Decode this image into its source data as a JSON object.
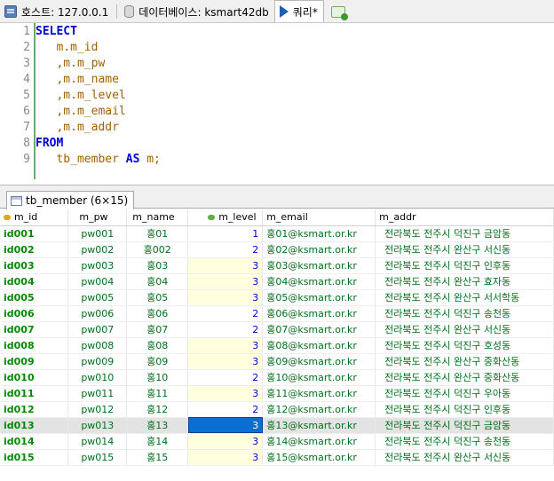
{
  "tabs": [
    {
      "label": "호스트: 127.0.0.1",
      "icon": "host-icon"
    },
    {
      "label": "데이터베이스: ksmart42db",
      "icon": "database-icon"
    },
    {
      "label": "쿼리*",
      "icon": "query-play-icon"
    }
  ],
  "editor": {
    "lines": [
      {
        "num": "1",
        "parts": [
          {
            "t": "SELECT",
            "c": "kw"
          }
        ]
      },
      {
        "num": "2",
        "parts": [
          {
            "t": "   m.m_id",
            "c": "id"
          }
        ]
      },
      {
        "num": "3",
        "parts": [
          {
            "t": "   ,m.m_pw",
            "c": "id"
          }
        ]
      },
      {
        "num": "4",
        "parts": [
          {
            "t": "   ,m.m_name",
            "c": "id"
          }
        ]
      },
      {
        "num": "5",
        "parts": [
          {
            "t": "   ,m.m_level",
            "c": "id"
          }
        ]
      },
      {
        "num": "6",
        "parts": [
          {
            "t": "   ,m.m_email",
            "c": "id"
          }
        ]
      },
      {
        "num": "7",
        "parts": [
          {
            "t": "   ,m.m_addr",
            "c": "id"
          }
        ]
      },
      {
        "num": "8",
        "parts": [
          {
            "t": "FROM",
            "c": "kw"
          }
        ]
      },
      {
        "num": "9",
        "parts": [
          {
            "t": "   tb_member ",
            "c": "id"
          },
          {
            "t": "AS",
            "c": "kw"
          },
          {
            "t": " m;",
            "c": "id"
          }
        ]
      }
    ]
  },
  "result_tab": {
    "label": "tb_member (6×15)"
  },
  "grid": {
    "columns": [
      "m_id",
      "m_pw",
      "m_name",
      "m_level",
      "m_email",
      "m_addr"
    ],
    "rows": [
      [
        "id001",
        "pw001",
        "홍01",
        "1",
        "홍01@ksmart.or.kr",
        "전라북도 전주시 덕진구 금암동"
      ],
      [
        "id002",
        "pw002",
        "홍002",
        "2",
        "홍02@ksmart.or.kr",
        "전라북도 전주시 완산구 서신동"
      ],
      [
        "id003",
        "pw003",
        "홍03",
        "3",
        "홍03@ksmart.or.kr",
        "전라북도 전주시 덕진구 인후동"
      ],
      [
        "id004",
        "pw004",
        "홍04",
        "3",
        "홍04@ksmart.or.kr",
        "전라북도 전주시 완산구 효자동"
      ],
      [
        "id005",
        "pw005",
        "홍05",
        "3",
        "홍05@ksmart.or.kr",
        "전라북도 전주시 완산구 서서학동"
      ],
      [
        "id006",
        "pw006",
        "홍06",
        "2",
        "홍06@ksmart.or.kr",
        "전라북도 전주시 덕진구 송천동"
      ],
      [
        "id007",
        "pw007",
        "홍07",
        "2",
        "홍07@ksmart.or.kr",
        "전라북도 전주시 완산구 서신동"
      ],
      [
        "id008",
        "pw008",
        "홍08",
        "3",
        "홍08@ksmart.or.kr",
        "전라북도 전주시 덕진구 호성동"
      ],
      [
        "id009",
        "pw009",
        "홍09",
        "3",
        "홍09@ksmart.or.kr",
        "전라북도 전주시 완산구 중화산동"
      ],
      [
        "id010",
        "pw010",
        "홍10",
        "2",
        "홍10@ksmart.or.kr",
        "전라북도 전주시 완산구 중화산동"
      ],
      [
        "id011",
        "pw011",
        "홍11",
        "3",
        "홍11@ksmart.or.kr",
        "전라북도 전주시 덕진구 우아동"
      ],
      [
        "id012",
        "pw012",
        "홍12",
        "2",
        "홍12@ksmart.or.kr",
        "전라북도 전주시 덕진구 인후동"
      ],
      [
        "id013",
        "pw013",
        "홍13",
        "3",
        "홍13@ksmart.or.kr",
        "전라북도 전주시 덕진구 금암동"
      ],
      [
        "id014",
        "pw014",
        "홍14",
        "3",
        "홍14@ksmart.or.kr",
        "전라북도 전주시 덕진구 송천동"
      ],
      [
        "id015",
        "pw015",
        "홍15",
        "3",
        "홍15@ksmart.or.kr",
        "전라북도 전주시 완산구 서신동"
      ]
    ],
    "selected_row": 12
  }
}
